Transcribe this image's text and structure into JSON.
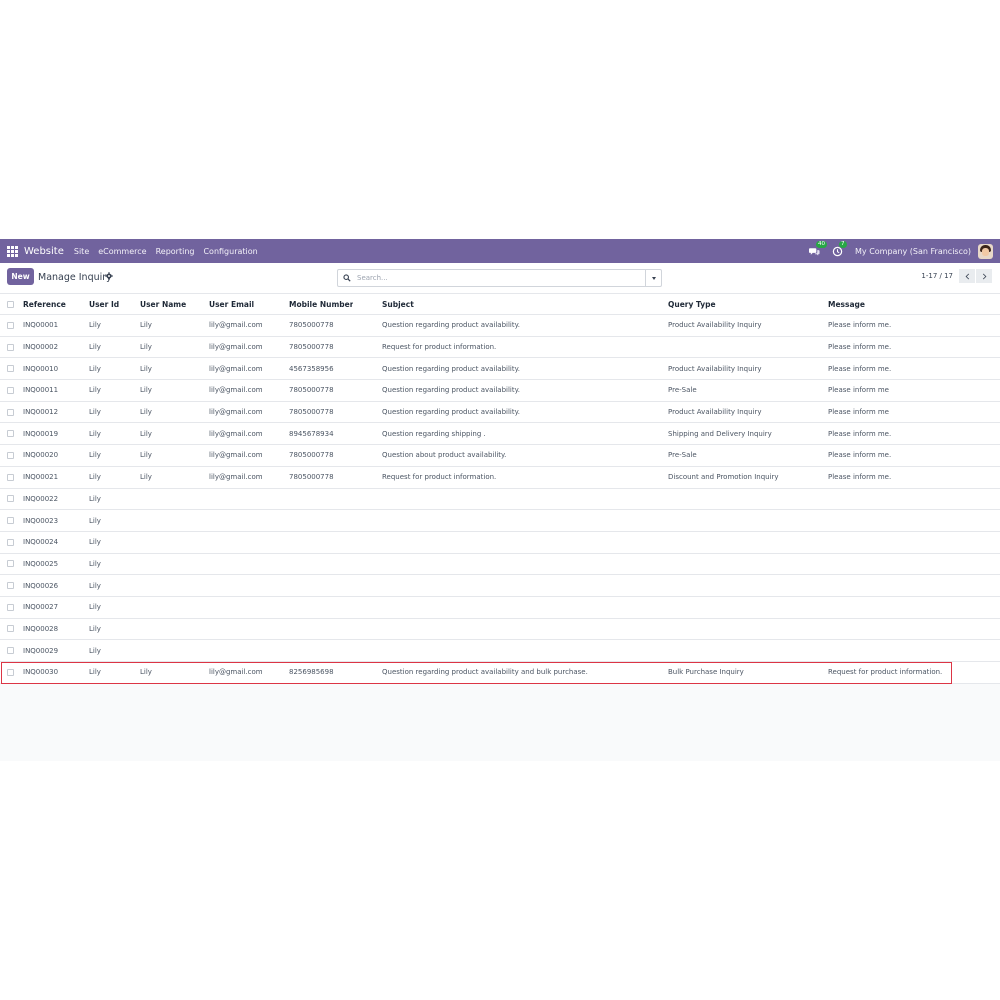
{
  "navbar": {
    "brand": "Website",
    "menu": [
      "Site",
      "eCommerce",
      "Reporting",
      "Configuration"
    ],
    "messages_badge": "40",
    "activities_badge": "7",
    "company": "My Company (San Francisco)"
  },
  "control": {
    "new_label": "New",
    "title": "Manage Inquiry",
    "search_placeholder": "Search...",
    "pager": "1-17 / 17"
  },
  "table": {
    "headers": {
      "reference": "Reference",
      "user_id": "User Id",
      "user_name": "User Name",
      "user_email": "User Email",
      "mobile": "Mobile Number",
      "subject": "Subject",
      "query_type": "Query Type",
      "message": "Message"
    },
    "rows": [
      {
        "reference": "INQ00001",
        "user_id": "Lily",
        "user_name": "Lily",
        "user_email": "lily@gmail.com",
        "mobile": "7805000778",
        "subject": "Question regarding product availability.",
        "query_type": "Product Availability Inquiry",
        "message": "Please inform me."
      },
      {
        "reference": "INQ00002",
        "user_id": "Lily",
        "user_name": "Lily",
        "user_email": "lily@gmail.com",
        "mobile": "7805000778",
        "subject": "Request for product information.",
        "query_type": "",
        "message": "Please inform me."
      },
      {
        "reference": "INQ00010",
        "user_id": "Lily",
        "user_name": "Lily",
        "user_email": "lily@gmail.com",
        "mobile": "4567358956",
        "subject": "Question regarding product availability.",
        "query_type": "Product Availability Inquiry",
        "message": "Please inform me."
      },
      {
        "reference": "INQ00011",
        "user_id": "Lily",
        "user_name": "Lily",
        "user_email": "lily@gmail.com",
        "mobile": "7805000778",
        "subject": "Question regarding product availability.",
        "query_type": "Pre-Sale",
        "message": "Please inform me"
      },
      {
        "reference": "INQ00012",
        "user_id": "Lily",
        "user_name": "Lily",
        "user_email": "lily@gmail.com",
        "mobile": "7805000778",
        "subject": "Question regarding product availability.",
        "query_type": "Product Availability Inquiry",
        "message": "Please inform me"
      },
      {
        "reference": "INQ00019",
        "user_id": "Lily",
        "user_name": "Lily",
        "user_email": "lily@gmail.com",
        "mobile": "8945678934",
        "subject": "Question regarding shipping .",
        "query_type": "Shipping and Delivery Inquiry",
        "message": "Please inform me."
      },
      {
        "reference": "INQ00020",
        "user_id": "Lily",
        "user_name": "Lily",
        "user_email": "lily@gmail.com",
        "mobile": "7805000778",
        "subject": "Question about product availability.",
        "query_type": "Pre-Sale",
        "message": "Please inform me."
      },
      {
        "reference": "INQ00021",
        "user_id": "Lily",
        "user_name": "Lily",
        "user_email": "lily@gmail.com",
        "mobile": "7805000778",
        "subject": "Request for product information.",
        "query_type": "Discount and Promotion Inquiry",
        "message": "Please inform me."
      },
      {
        "reference": "INQ00022",
        "user_id": "Lily",
        "user_name": "",
        "user_email": "",
        "mobile": "",
        "subject": "",
        "query_type": "",
        "message": ""
      },
      {
        "reference": "INQ00023",
        "user_id": "Lily",
        "user_name": "",
        "user_email": "",
        "mobile": "",
        "subject": "",
        "query_type": "",
        "message": ""
      },
      {
        "reference": "INQ00024",
        "user_id": "Lily",
        "user_name": "",
        "user_email": "",
        "mobile": "",
        "subject": "",
        "query_type": "",
        "message": ""
      },
      {
        "reference": "INQ00025",
        "user_id": "Lily",
        "user_name": "",
        "user_email": "",
        "mobile": "",
        "subject": "",
        "query_type": "",
        "message": ""
      },
      {
        "reference": "INQ00026",
        "user_id": "Lily",
        "user_name": "",
        "user_email": "",
        "mobile": "",
        "subject": "",
        "query_type": "",
        "message": ""
      },
      {
        "reference": "INQ00027",
        "user_id": "Lily",
        "user_name": "",
        "user_email": "",
        "mobile": "",
        "subject": "",
        "query_type": "",
        "message": ""
      },
      {
        "reference": "INQ00028",
        "user_id": "Lily",
        "user_name": "",
        "user_email": "",
        "mobile": "",
        "subject": "",
        "query_type": "",
        "message": ""
      },
      {
        "reference": "INQ00029",
        "user_id": "Lily",
        "user_name": "",
        "user_email": "",
        "mobile": "",
        "subject": "",
        "query_type": "",
        "message": ""
      },
      {
        "reference": "INQ00030",
        "user_id": "Lily",
        "user_name": "Lily",
        "user_email": "lily@gmail.com",
        "mobile": "8256985698",
        "subject": "Question regarding product availability and bulk purchase.",
        "query_type": "Bulk Purchase Inquiry",
        "message": "Request for product information.",
        "highlighted": true
      }
    ]
  },
  "colors": {
    "navbar": "#71639e",
    "primary_button": "#71639e",
    "highlight_border": "#dc3545",
    "badge": "#28a745"
  }
}
